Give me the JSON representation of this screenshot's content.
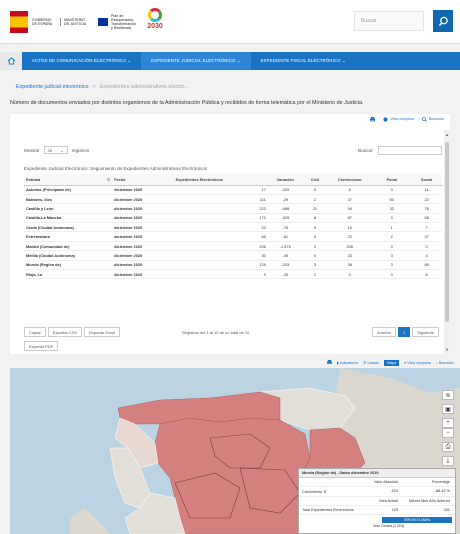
{
  "header": {
    "ministry_line1": "GOBIERNO DE ESPAÑA",
    "ministry_line2": "MINISTERIO DE JUSTICIA",
    "ue_text": "Plan de Recuperación, Transformación y Resiliencia",
    "agenda": "2030",
    "search_placeholder": "Buscar"
  },
  "nav": {
    "items": [
      {
        "label": "ACTOS DE COMUNICACIÓN ELECTRÓNICA ⌄"
      },
      {
        "label": "EXPEDIENTE JUDICIAL ELECTRÓNICO ⌄"
      },
      {
        "label": "EXPEDIENTE FISCAL ELECTRÓNICO ⌄"
      }
    ]
  },
  "breadcrumb": {
    "root": "Expediente judicial electrónico",
    "current": "Expedientes administrativos electró..."
  },
  "description": "Número de documentos enviados por distintos organismos de la Administración Pública y recibidos de forma telemática por el Ministerio de Justicia.",
  "table_toolbar": {
    "view_label": "Vista completa",
    "search_label": "Buscador"
  },
  "controls": {
    "show": "Mostrar",
    "page_size": "25",
    "records": "registros",
    "search": "Buscar:"
  },
  "table": {
    "title": "Expediente Judicial Electrónico: Seguimiento de Expedientes Administrativos Electrónicos",
    "columns": [
      "Entidad",
      "Fecha",
      "Expedientes Electrónicos",
      "Variación",
      "Civil",
      "Contencioso",
      "Penal",
      "Social"
    ],
    "rows": [
      [
        "Asturias (Principado de)",
        "diciembre 2020",
        "17",
        "-209",
        "0",
        "6",
        "0",
        "11"
      ],
      [
        "Baleares, Illes",
        "diciembre 2020",
        "111",
        "-29",
        "2",
        "37",
        "50",
        "22"
      ],
      [
        "Castilla y León",
        "diciembre 2020",
        "223",
        "-498",
        "21",
        "94",
        "32",
        "76"
      ],
      [
        "Castilla-La Mancha",
        "diciembre 2020",
        "172",
        "-329",
        "8",
        "87",
        "9",
        "68"
      ],
      [
        "Ceuta (Ciudad Autónoma)",
        "diciembre 2020",
        "22",
        "-78",
        "5",
        "10",
        "1",
        "7"
      ],
      [
        "Extremadura",
        "diciembre 2020",
        "66",
        "-61",
        "5",
        "22",
        "2",
        "37"
      ],
      [
        "Madrid (Comunidad de)",
        "diciembre 2020",
        "206",
        "-1.575",
        "0",
        "206",
        "0",
        "0"
      ],
      [
        "Melilla (Ciudad Autónoma)",
        "diciembre 2020",
        "30",
        "-49",
        "0",
        "23",
        "3",
        "4"
      ],
      [
        "Murcia (Región de)",
        "diciembre 2020",
        "129",
        "-203",
        "3",
        "38",
        "3",
        "85"
      ],
      [
        "Rioja, La",
        "diciembre 2020",
        "9",
        "-43",
        "1",
        "0",
        "0",
        "8"
      ]
    ]
  },
  "footer": {
    "copy": "Copiar",
    "csv": "Exportar CSV",
    "excel": "Exportar Excel",
    "pdf": "Exportar PDF",
    "records_info": "Registros del 1 al 10 de un total de 10",
    "prev": "Anterior",
    "page": "1",
    "next": "Siguiente"
  },
  "map_toolbar": {
    "indicators": "Indicadores",
    "list": "Listado",
    "map": "Mapa",
    "full": "Vista completa",
    "search": "Buscador"
  },
  "popup": {
    "title": "Murcia (Región de) - Datos diciembre 2020",
    "col_abs": "Valor Absoluto",
    "col_pct": "Porcentaje",
    "growth_label": "Crecimiento",
    "growth_abs": "-203",
    "growth_pct": "-88.42 %",
    "col_cur": "Mes Actual",
    "col_prev": "Mismo Mes Año Anterior",
    "total_label": "Total Expedientes Electrónicos",
    "total_cur": "129",
    "total_prev": "432",
    "button": "VER EN EL MAPA",
    "extra": "Gran Canaria (2.23%)"
  },
  "colors": {
    "primary": "#1b73c4",
    "region_fill": "#d4807f",
    "sea": "#bcd3e4"
  }
}
